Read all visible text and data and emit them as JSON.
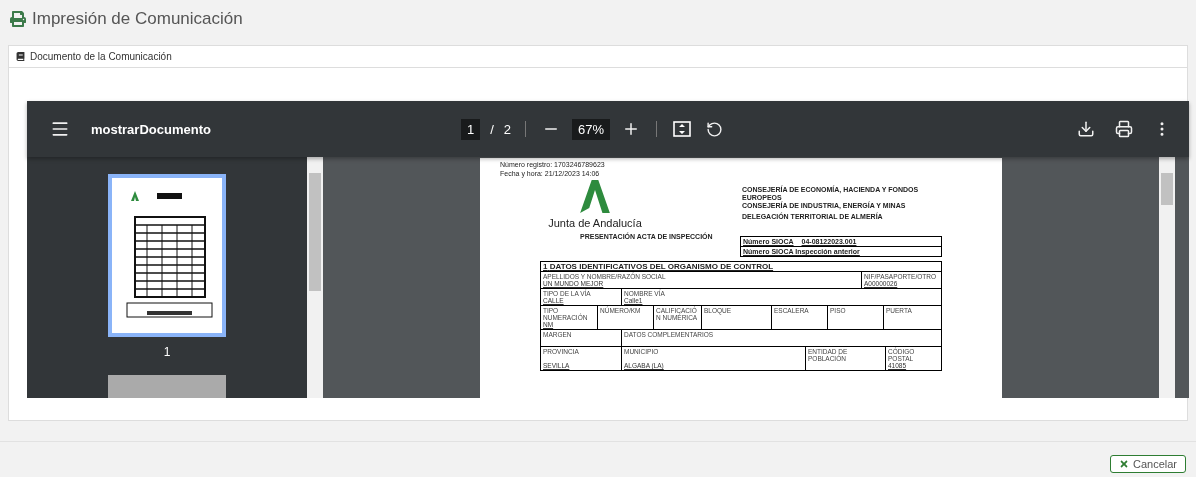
{
  "header": {
    "title": "Impresión de Comunicación"
  },
  "panel": {
    "title": "Documento de la Comunicación"
  },
  "viewer": {
    "file_name": "mostrarDocumento",
    "page": "1",
    "separator": "/",
    "page_count": "2",
    "zoom": "67%",
    "thumbnails": [
      {
        "label": "1",
        "selected": true
      },
      {
        "selected": false
      }
    ],
    "document": {
      "registry": "Número registro: 1703246789623",
      "datetime": "Fecha y hora: 21/12/2023 14:06",
      "org": "Junta de Andalucía",
      "departments": [
        "CONSEJERÍA DE ECONOMÍA, HACIENDA Y FONDOS EUROPEOS",
        "CONSEJERÍA DE INDUSTRIA, ENERGÍA Y MINAS"
      ],
      "delegation": "DELEGACIÓN TERRITORIAL DE ALMERÍA",
      "doc_title": "PRESENTACIÓN ACTA DE INSPECCIÓN",
      "references": [
        {
          "label": "Número SIOCA",
          "value": "04-08122023.001"
        },
        {
          "label": "Número SIOCA Inspección anterior"
        }
      ],
      "section": {
        "number": "1",
        "title": "DATOS IDENTIFICATIVOS DEL ORGANISMO DE CONTROL",
        "form_lines": [
          {
            "fields": [
              {
                "label": "APELLIDOS Y NOMBRE/RAZÓN SOCIAL",
                "value": "UN MUNDO MEJOR"
              },
              {
                "label": "NIF/PASAPORTE/OTRO",
                "value": "A00000026"
              }
            ]
          },
          {
            "fields": [
              {
                "label": "TIPO DE LA VÍA",
                "value": "CALLE"
              },
              {
                "label": "NOMBRE VÍA",
                "value": "Calle1"
              }
            ]
          },
          {
            "fields": [
              {
                "label": "TIPO NUMERACIÓN",
                "value": "NM"
              },
              {
                "label": "NÚMERO/KM"
              },
              {
                "label": "CALIFICACIÓN NUMÉRICA"
              },
              {
                "label": "BLOQUE"
              },
              {
                "label": "ESCALERA"
              },
              {
                "label": "PISO"
              },
              {
                "label": "PUERTA"
              }
            ]
          },
          {
            "fields": [
              {
                "label": "MARGEN"
              },
              {
                "label": "DATOS COMPLEMENTARIOS"
              }
            ]
          },
          {
            "fields": [
              {
                "label": "PROVINCIA",
                "value": "SEVILLA"
              },
              {
                "label": "MUNICIPIO",
                "value": "ALGABA (LA)"
              },
              {
                "label": "ENTIDAD DE POBLACIÓN"
              },
              {
                "label": "CÓDIGO POSTAL",
                "value": "41085"
              }
            ]
          }
        ]
      }
    }
  },
  "footer": {
    "cancel": "Cancelar"
  }
}
